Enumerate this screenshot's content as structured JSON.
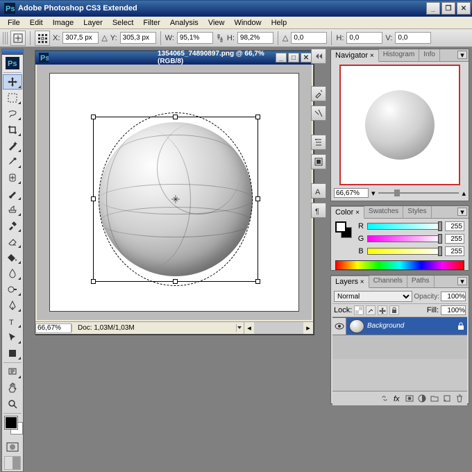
{
  "titlebar": {
    "title": "Adobe Photoshop CS3 Extended"
  },
  "menu": {
    "items": [
      "File",
      "Edit",
      "Image",
      "Layer",
      "Select",
      "Filter",
      "Analysis",
      "View",
      "Window",
      "Help"
    ]
  },
  "options": {
    "x_label": "X:",
    "x": "307,5 px",
    "y_label": "Y:",
    "y": "305,3 px",
    "w_label": "W:",
    "w": "95,1%",
    "h_label": "H:",
    "h": "98,2%",
    "angle": "0,0",
    "skew_h_label": "H:",
    "skew_h": "0,0",
    "skew_v_label": "V:",
    "skew_v": "0,0"
  },
  "doc": {
    "title": "1354065_74890897.png @ 66,7% (RGB/8)",
    "zoom": "66,67%",
    "info": "Doc: 1,03M/1,03M"
  },
  "navigator": {
    "tabs": [
      "Navigator",
      "Histogram",
      "Info"
    ],
    "zoom": "66,67%"
  },
  "color": {
    "tabs": [
      "Color",
      "Swatches",
      "Styles"
    ],
    "r_label": "R",
    "r": "255",
    "g_label": "G",
    "g": "255",
    "b_label": "B",
    "b": "255"
  },
  "layers": {
    "tabs": [
      "Layers",
      "Channels",
      "Paths"
    ],
    "blend": "Normal",
    "opacity_label": "Opacity:",
    "opacity": "100%",
    "lock_label": "Lock:",
    "fill_label": "Fill:",
    "fill": "100%",
    "layer_name": "Background"
  }
}
